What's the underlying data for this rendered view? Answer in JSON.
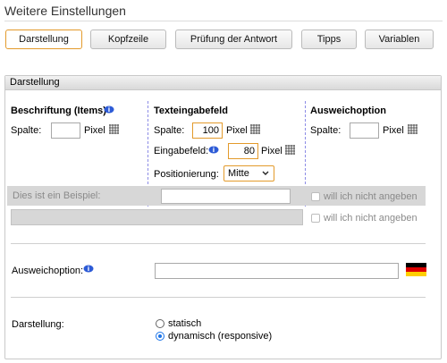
{
  "section_title": "Weitere Einstellungen",
  "tabs": [
    {
      "label": "Darstellung",
      "active": true
    },
    {
      "label": "Kopfzeile",
      "active": false
    },
    {
      "label": "Prüfung der Antwort",
      "active": false
    },
    {
      "label": "Tipps",
      "active": false
    },
    {
      "label": "Variablen",
      "active": false
    }
  ],
  "panel": {
    "title": "Darstellung",
    "col1": {
      "title": "Beschriftung (Items)",
      "spalte_label": "Spalte:",
      "spalte_value": "",
      "unit": "Pixel"
    },
    "col2": {
      "title": "Texteingabefeld",
      "spalte_label": "Spalte:",
      "spalte_value": "100",
      "unit": "Pixel",
      "eingabe_label": "Eingabefeld:",
      "eingabe_value": "80",
      "pos_label": "Positionierung:",
      "pos_value": "Mitte"
    },
    "col3": {
      "title": "Ausweichoption",
      "spalte_label": "Spalte:",
      "spalte_value": "",
      "unit": "Pixel"
    },
    "example_text": "Dies ist ein Beispiel:",
    "opt_text_1": "will ich nicht angeben",
    "opt_text_2": "will ich nicht angeben",
    "ausweich_label": "Ausweichoption:",
    "darstellung_label": "Darstellung:",
    "radio_static": "statisch",
    "radio_dynamic": "dynamisch (responsive)",
    "selected_radio": "dynamisch"
  },
  "colors": {
    "accent": "#e39a2b",
    "radio": "#1a73e8",
    "divider": "#8c8ce6"
  },
  "icons": [
    "info-icon",
    "grid-resize-icon",
    "flag-de-icon",
    "chevron-down-icon"
  ]
}
